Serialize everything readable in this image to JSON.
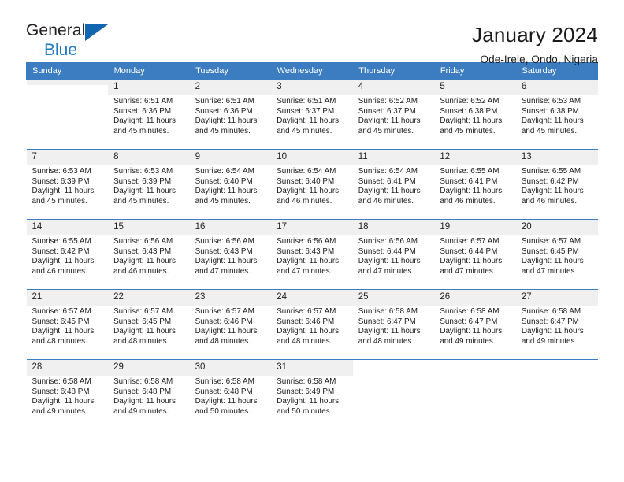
{
  "brand": {
    "word1": "General",
    "word2": "Blue",
    "triangle_color": "#1266b0",
    "blue_color": "#1f7ac0"
  },
  "header": {
    "title": "January 2024",
    "subtitle": "Ode-Irele, Ondo, Nigeria"
  },
  "theme": {
    "header_row_bg": "#3b7dc0",
    "header_row_text": "#ffffff",
    "daynum_bg": "#f0f0f0",
    "grid_line": "#3b7dc0"
  },
  "weekday_headers": [
    "Sunday",
    "Monday",
    "Tuesday",
    "Wednesday",
    "Thursday",
    "Friday",
    "Saturday"
  ],
  "weeks": [
    [
      {
        "day": "",
        "sunrise": "",
        "sunset": "",
        "daylight1": "",
        "daylight2": "",
        "empty": true
      },
      {
        "day": "1",
        "sunrise": "Sunrise: 6:51 AM",
        "sunset": "Sunset: 6:36 PM",
        "daylight1": "Daylight: 11 hours",
        "daylight2": "and 45 minutes."
      },
      {
        "day": "2",
        "sunrise": "Sunrise: 6:51 AM",
        "sunset": "Sunset: 6:36 PM",
        "daylight1": "Daylight: 11 hours",
        "daylight2": "and 45 minutes."
      },
      {
        "day": "3",
        "sunrise": "Sunrise: 6:51 AM",
        "sunset": "Sunset: 6:37 PM",
        "daylight1": "Daylight: 11 hours",
        "daylight2": "and 45 minutes."
      },
      {
        "day": "4",
        "sunrise": "Sunrise: 6:52 AM",
        "sunset": "Sunset: 6:37 PM",
        "daylight1": "Daylight: 11 hours",
        "daylight2": "and 45 minutes."
      },
      {
        "day": "5",
        "sunrise": "Sunrise: 6:52 AM",
        "sunset": "Sunset: 6:38 PM",
        "daylight1": "Daylight: 11 hours",
        "daylight2": "and 45 minutes."
      },
      {
        "day": "6",
        "sunrise": "Sunrise: 6:53 AM",
        "sunset": "Sunset: 6:38 PM",
        "daylight1": "Daylight: 11 hours",
        "daylight2": "and 45 minutes."
      }
    ],
    [
      {
        "day": "7",
        "sunrise": "Sunrise: 6:53 AM",
        "sunset": "Sunset: 6:39 PM",
        "daylight1": "Daylight: 11 hours",
        "daylight2": "and 45 minutes."
      },
      {
        "day": "8",
        "sunrise": "Sunrise: 6:53 AM",
        "sunset": "Sunset: 6:39 PM",
        "daylight1": "Daylight: 11 hours",
        "daylight2": "and 45 minutes."
      },
      {
        "day": "9",
        "sunrise": "Sunrise: 6:54 AM",
        "sunset": "Sunset: 6:40 PM",
        "daylight1": "Daylight: 11 hours",
        "daylight2": "and 45 minutes."
      },
      {
        "day": "10",
        "sunrise": "Sunrise: 6:54 AM",
        "sunset": "Sunset: 6:40 PM",
        "daylight1": "Daylight: 11 hours",
        "daylight2": "and 46 minutes."
      },
      {
        "day": "11",
        "sunrise": "Sunrise: 6:54 AM",
        "sunset": "Sunset: 6:41 PM",
        "daylight1": "Daylight: 11 hours",
        "daylight2": "and 46 minutes."
      },
      {
        "day": "12",
        "sunrise": "Sunrise: 6:55 AM",
        "sunset": "Sunset: 6:41 PM",
        "daylight1": "Daylight: 11 hours",
        "daylight2": "and 46 minutes."
      },
      {
        "day": "13",
        "sunrise": "Sunrise: 6:55 AM",
        "sunset": "Sunset: 6:42 PM",
        "daylight1": "Daylight: 11 hours",
        "daylight2": "and 46 minutes."
      }
    ],
    [
      {
        "day": "14",
        "sunrise": "Sunrise: 6:55 AM",
        "sunset": "Sunset: 6:42 PM",
        "daylight1": "Daylight: 11 hours",
        "daylight2": "and 46 minutes."
      },
      {
        "day": "15",
        "sunrise": "Sunrise: 6:56 AM",
        "sunset": "Sunset: 6:43 PM",
        "daylight1": "Daylight: 11 hours",
        "daylight2": "and 46 minutes."
      },
      {
        "day": "16",
        "sunrise": "Sunrise: 6:56 AM",
        "sunset": "Sunset: 6:43 PM",
        "daylight1": "Daylight: 11 hours",
        "daylight2": "and 47 minutes."
      },
      {
        "day": "17",
        "sunrise": "Sunrise: 6:56 AM",
        "sunset": "Sunset: 6:43 PM",
        "daylight1": "Daylight: 11 hours",
        "daylight2": "and 47 minutes."
      },
      {
        "day": "18",
        "sunrise": "Sunrise: 6:56 AM",
        "sunset": "Sunset: 6:44 PM",
        "daylight1": "Daylight: 11 hours",
        "daylight2": "and 47 minutes."
      },
      {
        "day": "19",
        "sunrise": "Sunrise: 6:57 AM",
        "sunset": "Sunset: 6:44 PM",
        "daylight1": "Daylight: 11 hours",
        "daylight2": "and 47 minutes."
      },
      {
        "day": "20",
        "sunrise": "Sunrise: 6:57 AM",
        "sunset": "Sunset: 6:45 PM",
        "daylight1": "Daylight: 11 hours",
        "daylight2": "and 47 minutes."
      }
    ],
    [
      {
        "day": "21",
        "sunrise": "Sunrise: 6:57 AM",
        "sunset": "Sunset: 6:45 PM",
        "daylight1": "Daylight: 11 hours",
        "daylight2": "and 48 minutes."
      },
      {
        "day": "22",
        "sunrise": "Sunrise: 6:57 AM",
        "sunset": "Sunset: 6:45 PM",
        "daylight1": "Daylight: 11 hours",
        "daylight2": "and 48 minutes."
      },
      {
        "day": "23",
        "sunrise": "Sunrise: 6:57 AM",
        "sunset": "Sunset: 6:46 PM",
        "daylight1": "Daylight: 11 hours",
        "daylight2": "and 48 minutes."
      },
      {
        "day": "24",
        "sunrise": "Sunrise: 6:57 AM",
        "sunset": "Sunset: 6:46 PM",
        "daylight1": "Daylight: 11 hours",
        "daylight2": "and 48 minutes."
      },
      {
        "day": "25",
        "sunrise": "Sunrise: 6:58 AM",
        "sunset": "Sunset: 6:47 PM",
        "daylight1": "Daylight: 11 hours",
        "daylight2": "and 48 minutes."
      },
      {
        "day": "26",
        "sunrise": "Sunrise: 6:58 AM",
        "sunset": "Sunset: 6:47 PM",
        "daylight1": "Daylight: 11 hours",
        "daylight2": "and 49 minutes."
      },
      {
        "day": "27",
        "sunrise": "Sunrise: 6:58 AM",
        "sunset": "Sunset: 6:47 PM",
        "daylight1": "Daylight: 11 hours",
        "daylight2": "and 49 minutes."
      }
    ],
    [
      {
        "day": "28",
        "sunrise": "Sunrise: 6:58 AM",
        "sunset": "Sunset: 6:48 PM",
        "daylight1": "Daylight: 11 hours",
        "daylight2": "and 49 minutes."
      },
      {
        "day": "29",
        "sunrise": "Sunrise: 6:58 AM",
        "sunset": "Sunset: 6:48 PM",
        "daylight1": "Daylight: 11 hours",
        "daylight2": "and 49 minutes."
      },
      {
        "day": "30",
        "sunrise": "Sunrise: 6:58 AM",
        "sunset": "Sunset: 6:48 PM",
        "daylight1": "Daylight: 11 hours",
        "daylight2": "and 50 minutes."
      },
      {
        "day": "31",
        "sunrise": "Sunrise: 6:58 AM",
        "sunset": "Sunset: 6:49 PM",
        "daylight1": "Daylight: 11 hours",
        "daylight2": "and 50 minutes."
      },
      {
        "day": "",
        "sunrise": "",
        "sunset": "",
        "daylight1": "",
        "daylight2": "",
        "blank": true
      },
      {
        "day": "",
        "sunrise": "",
        "sunset": "",
        "daylight1": "",
        "daylight2": "",
        "blank": true
      },
      {
        "day": "",
        "sunrise": "",
        "sunset": "",
        "daylight1": "",
        "daylight2": "",
        "blank": true
      }
    ]
  ]
}
